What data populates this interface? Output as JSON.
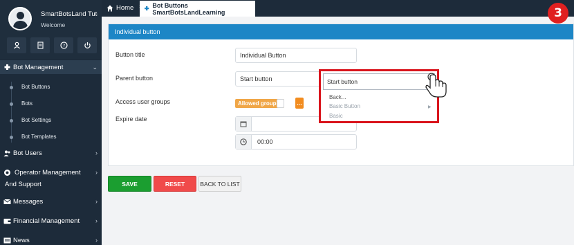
{
  "user": {
    "name": "SmartBotsLand Tuto",
    "welcome": "Welcome"
  },
  "user_icons": [
    "profile-icon",
    "document-icon",
    "help-icon",
    "power-icon"
  ],
  "sidebar": {
    "items": [
      {
        "label": "Bot Management",
        "icon": "puzzle-icon"
      },
      {
        "label": "Bot Users",
        "icon": "users-icon"
      },
      {
        "label": "Operator Management And Support",
        "icon": "support-icon"
      },
      {
        "label": "Messages",
        "icon": "envelope-icon"
      },
      {
        "label": "Financial Management",
        "icon": "wallet-icon"
      },
      {
        "label": "News",
        "icon": "newspaper-icon"
      }
    ],
    "subitems": [
      "Bot Buttons",
      "Bots",
      "Bot Settings",
      "Bot Templates"
    ]
  },
  "tabs": {
    "home": "Home",
    "active": "Bot Buttons SmartBotsLandLearning"
  },
  "step_badge": "3",
  "panel": {
    "header": "Individual button",
    "fields": {
      "button_title_label": "Button title",
      "button_title_value": "Individual Button",
      "parent_button_label": "Parent button",
      "parent_button_value": "Start button",
      "access_label": "Access user groups",
      "access_toggle": "Allowed groups",
      "more_button": "...",
      "expire_label": "Expire date",
      "expire_time": "00:00"
    }
  },
  "dropdown": {
    "selected": "Start button",
    "options": [
      "Back...",
      "Basic Button",
      "Basic"
    ]
  },
  "buttons": {
    "save": "SAVE",
    "reset": "RESET",
    "back": "BACK TO LIST"
  },
  "colors": {
    "sidebar": "#1d2b3a",
    "header": "#1d86c6",
    "save": "#1b9e30",
    "reset": "#f04a4a",
    "accent_orange": "#f0a647",
    "highlight_red": "#d9141c"
  }
}
